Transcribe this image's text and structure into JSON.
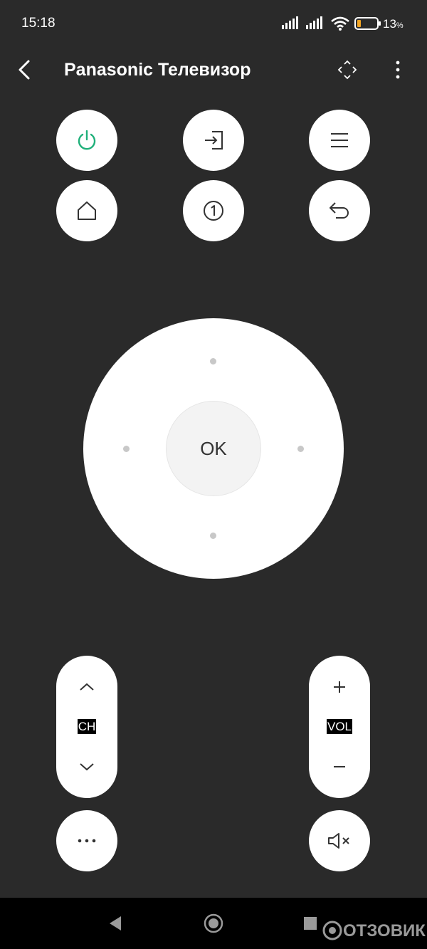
{
  "status": {
    "time": "15:18",
    "battery_percent": "13",
    "battery_unit": "%"
  },
  "header": {
    "title": "Panasonic Телевизор"
  },
  "remote": {
    "ok_label": "OK",
    "channel_label": "CH",
    "volume_label": "VOL"
  },
  "colors": {
    "background": "#2a2a2a",
    "button": "#ffffff",
    "power_accent": "#1fb07a",
    "battery_low": "#f5a623"
  },
  "watermark": {
    "text": "ОТЗОВИК"
  }
}
